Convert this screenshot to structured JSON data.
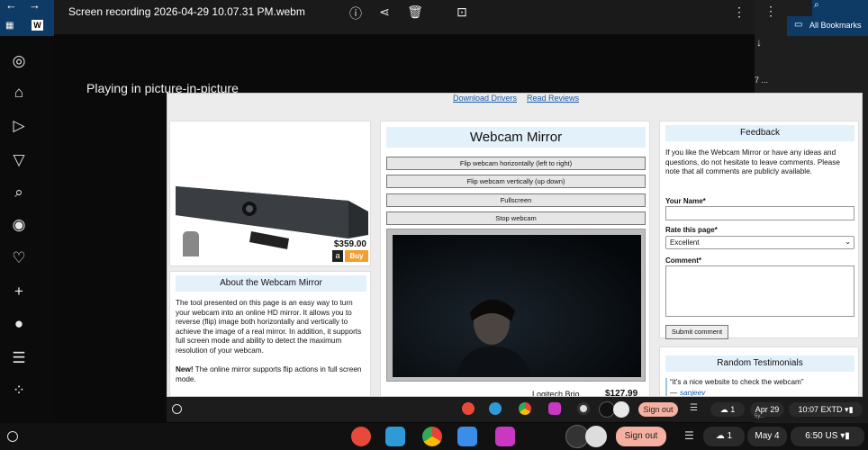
{
  "player": {
    "title": "Screen recording 2026-04-29 10.07.31 PM.webm",
    "pip_text": "Playing in picture-in-picture"
  },
  "browser": {
    "bookmarks_label": "All Bookmarks",
    "side_text": "7 ..."
  },
  "webpage": {
    "top_links": [
      "Download Drivers",
      "Read Reviews"
    ],
    "product_left": {
      "price": "$359.00",
      "buy_label": "Buy"
    },
    "about": {
      "heading": "About the Webcam Mirror",
      "paragraph": "The tool presented on this page is an easy way to turn your webcam into an online HD mirror. It allows you to reverse (flip) image both horizontally and vertically to achieve the image of a real mirror. In addition, it supports full screen mode and ability to detect the maximum resolution of your webcam.",
      "new_label": "New!",
      "new_text": " The online mirror supports flip actions in full screen mode."
    },
    "mirror": {
      "title": "Webcam Mirror",
      "buttons": [
        "Flip webcam horizontally (left to right)",
        "Flip webcam vertically (up down)",
        "Fullscreen",
        "Stop webcam"
      ],
      "product_name": "Logitech Brio",
      "product_price": "$127.99"
    },
    "feedback": {
      "heading": "Feedback",
      "intro": "If you like the Webcam Mirror or have any ideas and questions, do not hesitate to leave comments. Please note that all comments are publicly available.",
      "name_label": "Your Name*",
      "rate_label": "Rate this page*",
      "rate_selected": "Excellent",
      "comment_label": "Comment*",
      "submit_label": "Submit comment"
    },
    "testimonials": {
      "heading": "Random Testimonials",
      "quote": "“it's a nice website to check the webcam”",
      "author": "sanjeev",
      "dash": "— "
    }
  },
  "mini_shelf": {
    "sign_out": "Sign out",
    "badge": "1",
    "date": "Apr 29",
    "time": "10:07",
    "extd": "EXTD",
    "sub": "5y..."
  },
  "shelf": {
    "sign_out": "Sign out",
    "badge": "1",
    "date": "May 4",
    "time": "6:50",
    "region": "US"
  },
  "colors": {
    "chrome_blue": "#0e3a66",
    "buy_orange": "#f0a030",
    "sign_out": "#f4b0a0",
    "link": "#1a5ca8"
  }
}
